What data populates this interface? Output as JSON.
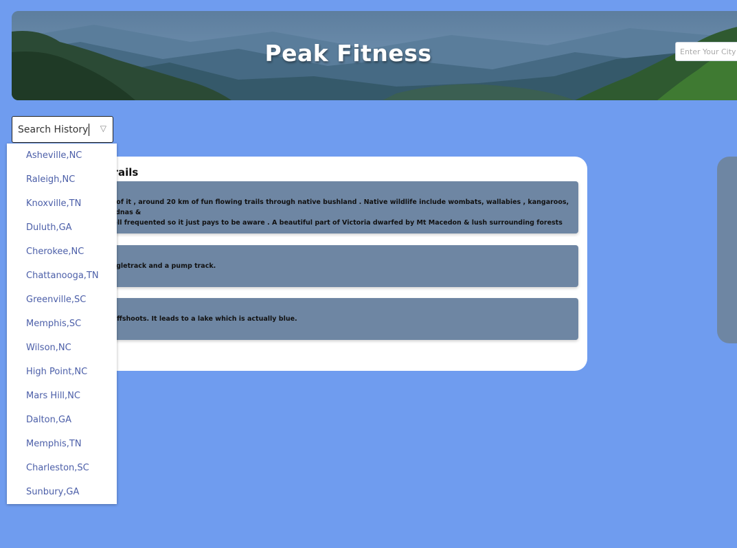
{
  "header": {
    "title": "Peak Fitness",
    "city_placeholder": "Enter Your City"
  },
  "search_history": {
    "label": "Search History",
    "options": [
      "Asheville,NC",
      "Raleigh,NC",
      "Knoxville,TN",
      "Duluth,GA",
      "Cherokee,NC",
      "Chattanooga,TN",
      "Greenville,SC",
      "Memphis,SC",
      "Wilson,NC",
      "High Point,NC",
      "Mars Hill,NC",
      "Dalton,GA",
      "Memphis,TN",
      "Charleston,SC",
      "Sunbury,GA"
    ]
  },
  "trails": {
    "heading_visible": "g Trails",
    "items": [
      {
        "line1": " lots of it , around 20 km of fun flowing trails through native bushland . Native wildlife include wombats, wallabies , kangaroos, echidnas &",
        "line2": "e well frequented so it just pays to be aware . A beautiful part of Victoria dwarfed by Mt Macedon & lush surrounding forests"
      },
      {
        "line1": "f singletrack and a pump track."
      },
      {
        "line1": "ral offshoots. It leads to a lake which is actually blue."
      }
    ]
  },
  "colors": {
    "page_background": "#6f9cef",
    "trail_card": "#6e86a3",
    "dropdown_text": "#4b5ea8"
  }
}
